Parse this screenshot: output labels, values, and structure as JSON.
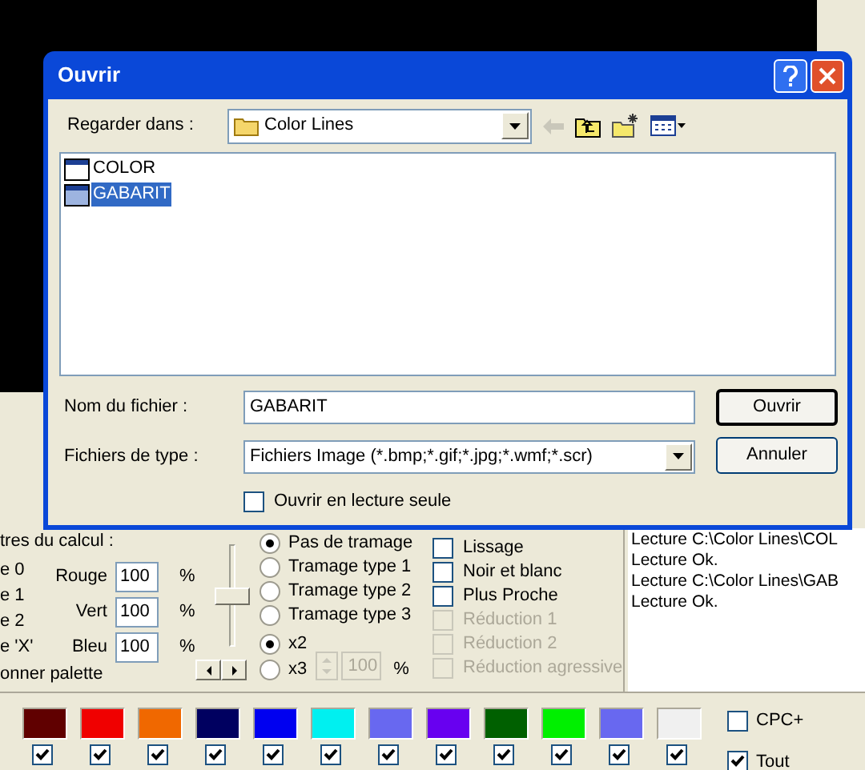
{
  "dialog": {
    "title": "Ouvrir",
    "look_in_label": "Regarder dans :",
    "look_in_value": "Color Lines",
    "files": [
      {
        "name": "COLOR",
        "selected": false
      },
      {
        "name": "GABARIT",
        "selected": true
      }
    ],
    "filename_label": "Nom du fichier :",
    "filename_value": "GABARIT",
    "filetype_label": "Fichiers de type :",
    "filetype_value": "Fichiers Image (*.bmp;*.gif;*.jpg;*.wmf;*.scr)",
    "readonly": {
      "label": "Ouvrir en lecture seule",
      "checked": false
    },
    "buttons": [
      "Ouvrir",
      "Annuler"
    ]
  },
  "app": {
    "group_label": "tres du calcul :",
    "modes": [
      "e 0",
      "e 1",
      "e 2",
      "e 'X'"
    ],
    "palette_label": "onner palette",
    "channels": [
      {
        "label": "Rouge",
        "value": "100",
        "unit": "%"
      },
      {
        "label": "Vert",
        "value": "100",
        "unit": "%"
      },
      {
        "label": "Bleu",
        "value": "100",
        "unit": "%"
      }
    ],
    "slider": {
      "level": 0.5
    },
    "dithering": [
      {
        "label": "Pas de tramage",
        "selected": true
      },
      {
        "label": "Tramage type 1",
        "selected": false
      },
      {
        "label": "Tramage type 2",
        "selected": false
      },
      {
        "label": "Tramage type 3",
        "selected": false
      }
    ],
    "zoom": [
      {
        "label": "x2",
        "selected": true
      },
      {
        "label": "x3",
        "selected": false
      }
    ],
    "zoom_value": "100",
    "zoom_unit": "%",
    "options": [
      {
        "label": "Lissage",
        "checked": false,
        "disabled": false
      },
      {
        "label": "Noir et blanc",
        "checked": false,
        "disabled": false
      },
      {
        "label": "Plus Proche",
        "checked": false,
        "disabled": false
      },
      {
        "label": "Réduction 1",
        "checked": false,
        "disabled": true
      },
      {
        "label": "Réduction 2",
        "checked": false,
        "disabled": true
      },
      {
        "label": "Réduction agressive",
        "checked": false,
        "disabled": true
      }
    ],
    "log": [
      "Lecture C:\\Color Lines\\COL",
      "Lecture Ok.",
      "Lecture C:\\Color Lines\\GAB",
      "Lecture Ok."
    ],
    "palette": [
      {
        "color": "#600000",
        "checked": true
      },
      {
        "color": "#f00000",
        "checked": true
      },
      {
        "color": "#f06800",
        "checked": true
      },
      {
        "color": "#000060",
        "checked": true
      },
      {
        "color": "#0000f0",
        "checked": true
      },
      {
        "color": "#00f0f0",
        "checked": true
      },
      {
        "color": "#6868f0",
        "checked": true
      },
      {
        "color": "#6800f0",
        "checked": true
      },
      {
        "color": "#006000",
        "checked": true
      },
      {
        "color": "#00f000",
        "checked": true
      },
      {
        "color": "#6868f0",
        "checked": true
      },
      {
        "color": "#f0f0f0",
        "checked": true
      }
    ],
    "cpc_plus": {
      "label": "CPC+",
      "checked": false
    },
    "all": {
      "label": "Tout",
      "checked": true
    }
  }
}
